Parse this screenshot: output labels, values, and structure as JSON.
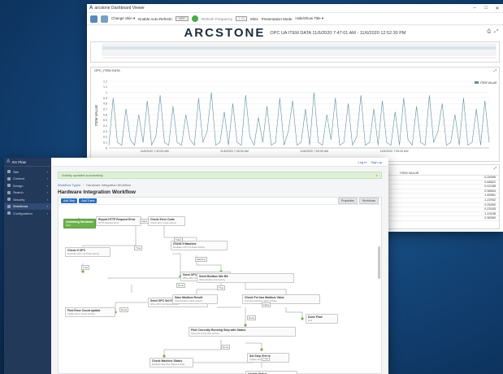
{
  "dashboard": {
    "window_title": "arcstone Dashboard Viewer",
    "toolbar": {
      "change_skin": "Change Skin ▾",
      "auto_refresh_label": "Enable Auto-Refresh",
      "auto_refresh_toggle": "OFF",
      "refresh_freq_label": "Refresh Frequency",
      "refresh_freq_value": "1.00",
      "refresh_unit": "Mins",
      "presentation_mode": "Presentation Mode",
      "hide_show_title": "Hide/Show Title ▾"
    },
    "brand": "ARCSTONE",
    "subtitle": "OPC UA ITEM DATA  11/6/2020 7:47:01 AM - 11/6/2020 12:52:30 PM",
    "chart_panel_title": "OPC_ITEM DATA",
    "table_header": "ITEM VALUE",
    "table_values": [
      "0.28395",
      "0.48622",
      "0.42188",
      "0.38654",
      "1.65561",
      "1.22932",
      "0.25392",
      "0.23183",
      "1.13198",
      "0.38360"
    ]
  },
  "chart_data": [
    {
      "type": "line",
      "title": "",
      "xlabel": "",
      "ylabel": "ITEM VALUE",
      "ylim": [
        0,
        1.2
      ],
      "yticks": [
        "1.2",
        "1.1",
        "1",
        "0.9",
        "0.8",
        "0.7",
        "0.6",
        "0.5",
        "0.4",
        "0.3",
        "0.2",
        "0.1",
        "0"
      ],
      "xtick_labels": [
        "11/6/2020 7:40:00 AM",
        "11/6/2020 7:45:00 AM",
        "11/6/2020 7:50:00 AM",
        "11/6/2020 7:55:00 AM"
      ],
      "legend": "ITEM VALUE",
      "series": [
        {
          "name": "ITEM VALUE",
          "color": "#5f8f9e",
          "values": [
            0.05,
            0.9,
            0.1,
            0.05,
            0.7,
            0.15,
            0.05,
            0.6,
            0.1,
            0.85,
            0.05,
            0.2,
            0.95,
            0.1,
            0.05,
            0.75,
            0.1,
            0.05,
            0.6,
            0.15,
            0.05,
            0.9,
            0.1,
            0.3,
            1.0,
            0.05,
            0.1,
            0.65,
            0.05,
            0.8,
            0.1,
            0.05,
            0.95,
            0.2,
            0.05,
            0.55,
            0.1,
            0.75,
            0.05,
            0.1,
            0.9,
            0.05,
            0.3,
            0.85,
            0.05,
            0.1,
            0.7,
            0.05,
            1.0,
            0.1,
            0.05,
            0.6,
            0.15,
            0.9,
            0.05,
            0.1,
            0.8,
            0.05,
            0.2,
            0.95,
            0.05,
            0.1,
            0.7,
            0.05,
            0.85,
            0.1,
            0.05,
            0.65,
            0.05,
            0.9,
            0.15,
            0.05,
            0.75,
            0.1,
            0.05,
            0.95,
            0.1,
            0.3,
            0.8,
            0.05,
            0.1,
            0.6,
            0.05,
            0.9,
            0.05,
            0.1,
            0.7,
            0.05,
            0.85,
            0.1
          ]
        }
      ]
    }
  ],
  "workflow": {
    "app_name": "Arc Flow",
    "sidebar": [
      {
        "label": "Site",
        "icon": "site-icon"
      },
      {
        "label": "Content",
        "icon": "content-icon"
      },
      {
        "label": "Design",
        "icon": "design-icon"
      },
      {
        "label": "Search",
        "icon": "search-icon"
      },
      {
        "label": "Security",
        "icon": "lock-icon"
      },
      {
        "label": "Workflows",
        "icon": "workflow-icon"
      },
      {
        "label": "Configuration",
        "icon": "gear-icon"
      }
    ],
    "top_links": [
      "Log in",
      "Sign up"
    ],
    "alert": "Activity updated successfully",
    "alert_close": "×",
    "breadcrumbs": [
      "Workflow Types",
      "/",
      "Hardware Integration Workflow"
    ],
    "page_title": "Hardware Integration Workflow",
    "canvas_buttons": [
      "Add Step",
      "Add Trans"
    ],
    "canvas_right_buttons": [
      "Properties",
      "Workflows"
    ],
    "nodes": [
      {
        "title": "Activating Hardware",
        "sub": "Start"
      },
      {
        "title": "Report HTTP Request Error",
        "sub": "HTTP Request Error"
      },
      {
        "title": "Check Error Code",
        "sub": "Check Error Code Activity"
      },
      {
        "title": "Check If Machine",
        "sub": "Evaluate OPC UA Node Activity"
      },
      {
        "title": "Check If OPC",
        "sub": "Evaluate OPC UA Node Activity"
      },
      {
        "title": "Send OPC Idle Bit",
        "sub": "Write OPC UA Node Activity"
      },
      {
        "title": "Send Modbus Idle Bit",
        "sub": "Write Modbus Coil Activity"
      },
      {
        "title": "Send OPC Set Failed",
        "sub": "Write OPC UA Node Activity"
      },
      {
        "title": "Save Modbus Result",
        "sub": "Save Modbus Value Activity"
      },
      {
        "title": "Check For two Modbus Value",
        "sub": "Compare Modbus Value Activity"
      },
      {
        "title": "Done Flow",
        "sub": "End"
      },
      {
        "title": "Find Error Count update",
        "sub": "Update Error Count Activity"
      },
      {
        "title": "Find Currently Running Step with Status",
        "sub": "Query Running Step Activity"
      },
      {
        "title": "Check Machine Status",
        "sub": "Evaluate Machine Status Activity"
      },
      {
        "title": "Set Step Status",
        "sub": "Update Step Activity"
      },
      {
        "title": "Update Status",
        "sub": "Update Status Activity"
      }
    ],
    "transitions": [
      "Fault",
      "True",
      "False",
      "Machine",
      "True",
      "Done",
      "True",
      "Done",
      "False",
      "Done",
      "Done",
      "True"
    ]
  }
}
